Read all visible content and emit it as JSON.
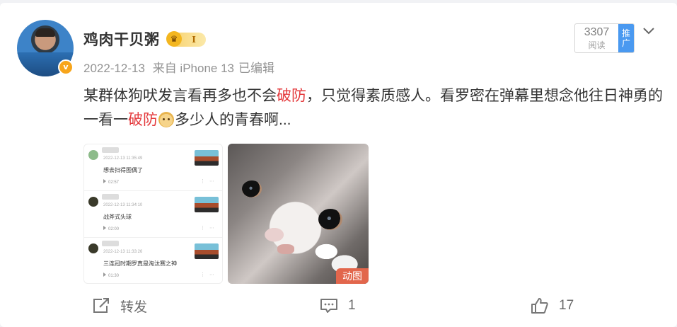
{
  "post": {
    "username": "鸡肉干贝粥",
    "level": "I",
    "verified_mark": "v",
    "date": "2022-12-13",
    "source": "来自 iPhone 13",
    "edited": "已编辑",
    "read_count": "3307",
    "read_label": "阅读",
    "promote_label": [
      "推",
      "广"
    ],
    "content": {
      "p1": "某群体狗吠发言看再多也不会",
      "h1": "破防",
      "p2": "，只觉得素质感人。看罗密在弹幕里想念他往日神勇的一看一",
      "h2": "破防",
      "p3": "多少人的青春啊..."
    },
    "gif_tag": "动图"
  },
  "comments": [
    {
      "time": "2022-12-13 11:35:49",
      "text": "想去扫得图偶了",
      "duration": "02:57"
    },
    {
      "time": "2022-12-13 11:34:10",
      "text": "战斧式头球",
      "duration": "02:00"
    },
    {
      "time": "2022-12-13 11:33:26",
      "text": "三连冠时期罗真是淘汰赛之神",
      "duration": "01:30"
    }
  ],
  "actions": {
    "repost_label": "转发",
    "comment_count": "1",
    "like_count": "17"
  },
  "icons": [
    "crown-icon",
    "chevron-down-icon",
    "repost-icon",
    "comment-icon",
    "like-icon",
    "play-icon"
  ],
  "colors": {
    "highlight": "#e4393c",
    "promote": "#4a99f0",
    "gif_tag": "#e2664c"
  }
}
